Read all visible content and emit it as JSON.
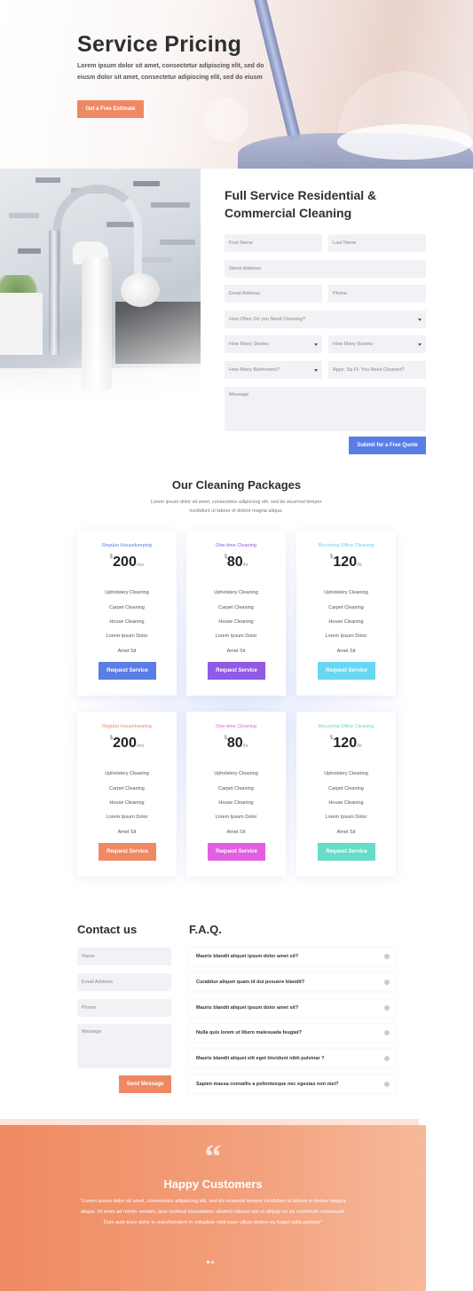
{
  "hero": {
    "title": "Service Pricing",
    "description": "Lorem ipsum dolor sit amet, consectetur adipiscing elit, sed do eiusm dolor sit amet, consectetur adipiscing elit, sed do eiusm",
    "cta": "Get a Free Estimate"
  },
  "quote_form": {
    "title": "Full Service Residential & Commercial Cleaning",
    "fields": {
      "first_name": "First Name",
      "last_name": "Last Name",
      "street": "Street Address",
      "email": "Email Address",
      "phone": "Phone",
      "frequency": "How Often Do you Need Cleaning?",
      "stories": "How Many Stories",
      "rooms": "How Many Rooms",
      "bathrooms": "How Many Bathrooms?",
      "sqft": "Appx. Sq Ft. You Need Cleaned?",
      "message": "Message"
    },
    "submit": "Submit for a Free Quote"
  },
  "packages": {
    "title": "Our Cleaning Packages",
    "description": "Lorem ipsum dolor sit amet, consectetur adipiscing elit, sed do eiusmod tempor incididunt ut labore et dolore magna aliqua.",
    "features": [
      "Upholstery Cleaning",
      "Carpet Cleaning",
      "House Cleaning",
      "Lorem Ipsum Dolor",
      "Amet Sit"
    ],
    "cards": [
      {
        "plan": "Regular Housekeeping",
        "currency": "$",
        "amount": "200",
        "period": "/mo",
        "button": "Request Service",
        "accent": "#5b7de6",
        "button_color": "#5b7de6"
      },
      {
        "plan": "One-time Cleaning",
        "currency": "$",
        "amount": "80",
        "period": "/hr",
        "button": "Request Service",
        "accent": "#8f5ae6",
        "button_color": "#8f5ae6"
      },
      {
        "plan": "Recurring Office Cleaning",
        "currency": "$",
        "amount": "120",
        "period": "/hr",
        "button": "Request Service",
        "accent": "#5fd0ef",
        "button_color": "#67d8f2"
      },
      {
        "plan": "Regular Housekeeping",
        "currency": "$",
        "amount": "200",
        "period": "/mo",
        "button": "Request Service",
        "accent": "#ef8963",
        "button_color": "#ef8963"
      },
      {
        "plan": "One-time Cleaning",
        "currency": "$",
        "amount": "80",
        "period": "/hr",
        "button": "Request Service",
        "accent": "#e25ee0",
        "button_color": "#e25ee0"
      },
      {
        "plan": "Recurring Office Cleaning",
        "currency": "$",
        "amount": "120",
        "period": "/hr",
        "button": "Request Service",
        "accent": "#5fd8c6",
        "button_color": "#66dcc9"
      }
    ]
  },
  "contact": {
    "title": "Contact us",
    "name": "Name",
    "email": "Email Address",
    "phone": "Phone",
    "message": "Message",
    "send": "Send Message"
  },
  "faq": {
    "title": "F.A.Q.",
    "items": [
      "Mauris blandit aliquet ipsum dolor amet sit?",
      "Curabitur aliquet quam id dui posuere blandit?",
      "Mauris blandit aliquet ipsum dolor amet sit?",
      "Nulla quis lorem ut libero malesuada feugiat?",
      "Mauris blandit aliquet elit eget tincidunt nibh pulvinar ?",
      "Sapien massa convallis a pellentesque nec egestas non nisi?"
    ]
  },
  "testimonial": {
    "quote_mark": "“",
    "title": "Happy Customers",
    "text": "\"Lorem ipsum dolor sit amet, consectetur adipiscing elit, sed do eiusmod tempor incididunt ut labore et dolore magna aliqua. Ut enim ad minim veniam, quis nostrud exercitation ullamco laboris nisi ut aliquip ex ea commodo consequat. Duis aute irure dolor in reprehenderit in voluptate velit esse cillum dolore eu fugiat nulla pariatur\""
  }
}
